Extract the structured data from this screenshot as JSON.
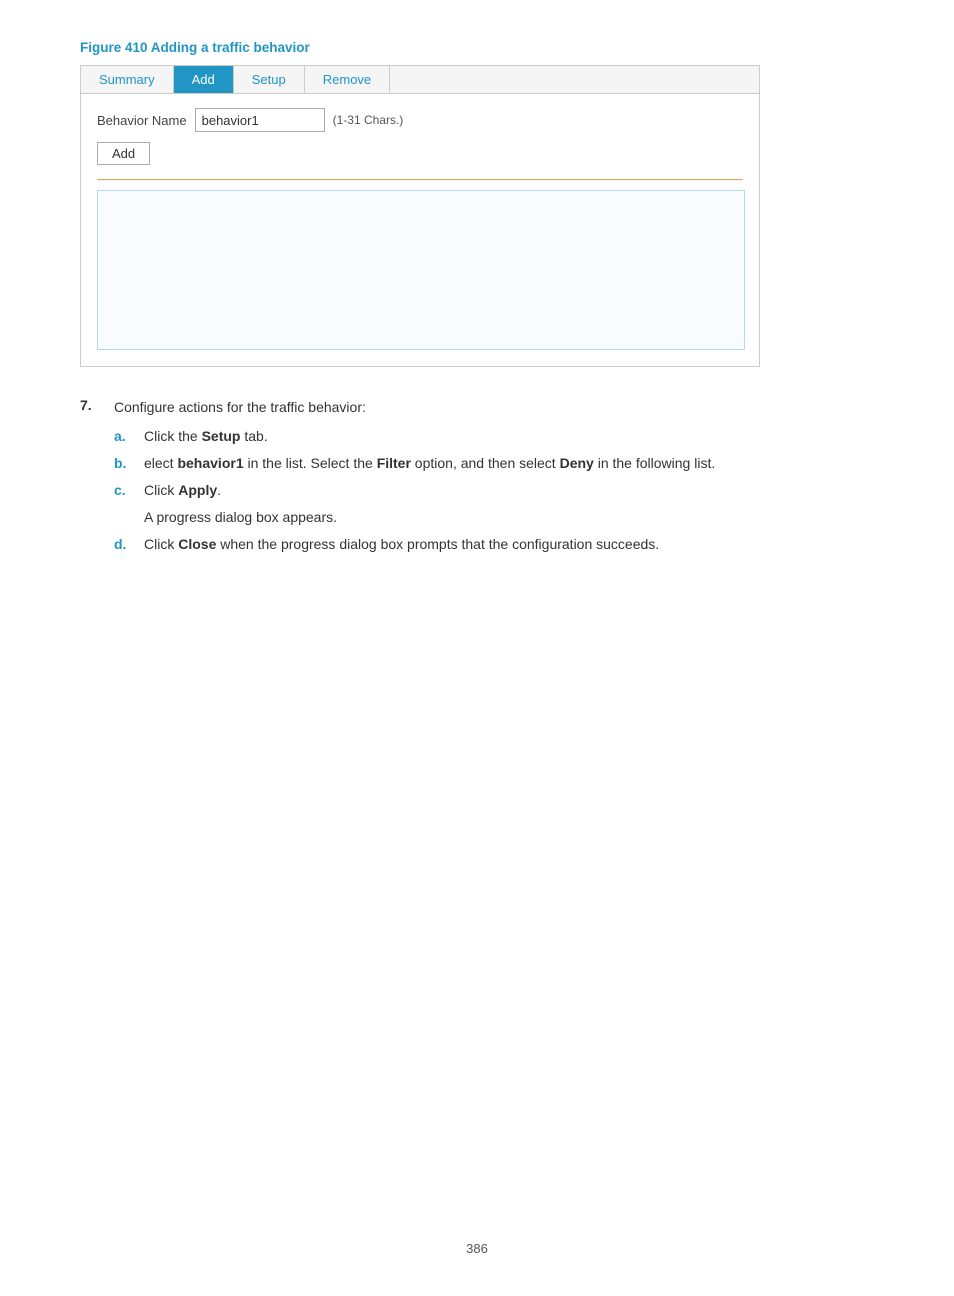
{
  "figure": {
    "caption": "Figure 410 Adding a traffic behavior"
  },
  "widget": {
    "tabs": [
      {
        "label": "Summary",
        "active": false
      },
      {
        "label": "Add",
        "active": true
      },
      {
        "label": "Setup",
        "active": false
      },
      {
        "label": "Remove",
        "active": false
      }
    ],
    "behavior_name_label": "Behavior Name",
    "behavior_name_value": "behavior1",
    "chars_hint": "(1-31 Chars.)",
    "add_button_label": "Add"
  },
  "step": {
    "number": "7.",
    "text": "Configure actions for the traffic behavior:",
    "sub_steps": [
      {
        "letter": "a.",
        "text": "Click the ",
        "bold": "Setup",
        "text2": " tab."
      },
      {
        "letter": "b.",
        "text": "elect ",
        "bold": "behavior1",
        "text2": " in the list. Select the ",
        "bold2": "Filter",
        "text3": " option, and then select ",
        "bold3": "Deny",
        "text4": " in the following list."
      },
      {
        "letter": "c.",
        "text": "Click ",
        "bold": "Apply",
        "text2": ".",
        "note": "A progress dialog box appears."
      },
      {
        "letter": "d.",
        "text": "Click ",
        "bold": "Close",
        "text2": " when the progress dialog box prompts that the configuration succeeds."
      }
    ]
  },
  "page_number": "386"
}
